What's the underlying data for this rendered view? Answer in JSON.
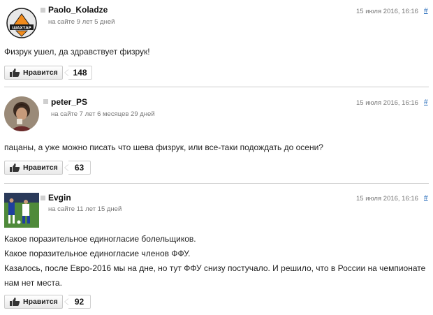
{
  "comments": [
    {
      "username": "Paolo_Koladze",
      "membership": "на сайте 9 лет 5 дней",
      "timestamp": "15 июля 2016, 16:16",
      "permalink": "#",
      "lines": [
        "Физрук ушел, да здравствует физрук!"
      ],
      "like_label": "Нравится",
      "likes": "148",
      "avatar_icon": "shakhtar-crest-icon"
    },
    {
      "username": "peter_PS",
      "membership": "на сайте 7 лет 6 месяцев 29 дней",
      "timestamp": "15 июля 2016, 16:16",
      "permalink": "#",
      "lines": [
        "пацаны, а уже можно писать что шева физрук, или все-таки подождать до осени?"
      ],
      "like_label": "Нравится",
      "likes": "63",
      "avatar_icon": "user-photo-icon"
    },
    {
      "username": "Evgin",
      "membership": "на сайте 11 лет 15 дней",
      "timestamp": "15 июля 2016, 16:16",
      "permalink": "#",
      "lines": [
        "Какое поразительное единогласие болельщиков.",
        "Какое поразительное единогласие членов ФФУ.",
        "Казалось, после Евро-2016 мы на дне, но тут ФФУ снизу постучало. И решило, что в России на чемпионате",
        "нам нет места."
      ],
      "like_label": "Нравится",
      "likes": "92",
      "avatar_icon": "football-players-photo-icon"
    }
  ]
}
